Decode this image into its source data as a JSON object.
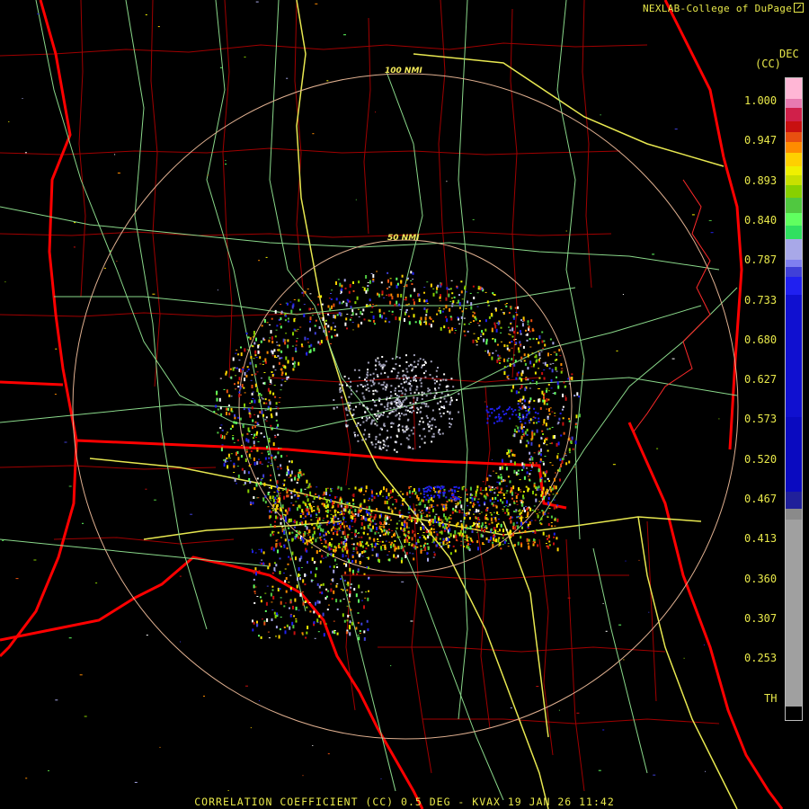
{
  "header": {
    "credit": "NEXLAB-College of DuPage"
  },
  "range_rings": [
    {
      "label": "100 NMI"
    },
    {
      "label": "50 NMI"
    }
  ],
  "legend": {
    "top_labels": [
      "DEC",
      "(CC)"
    ],
    "values": [
      "1.000",
      "0.947",
      "0.893",
      "0.840",
      "0.787",
      "0.733",
      "0.680",
      "0.627",
      "0.573",
      "0.520",
      "0.467",
      "0.413",
      "0.360",
      "0.307",
      "0.253",
      "TH"
    ],
    "colors": [
      "#ffb6d5",
      "#e87ab0",
      "#d0204a",
      "#c81010",
      "#e85010",
      "#ff8c00",
      "#ffd000",
      "#f0f000",
      "#c8e000",
      "#88d000",
      "#50c840",
      "#60ff60",
      "#30e060",
      "#a8a8e8",
      "#8080f0",
      "#4040d8",
      "#2020f0",
      "#1010d0",
      "#0a0ac0",
      "#20209a",
      "#8a8a8a",
      "#a0a0a0",
      "#000000"
    ]
  },
  "footer": {
    "text": "CORRELATION COEFFICIENT (CC) 0.5 DEG - KVAX 19 JAN 26 11:42"
  },
  "colors": {
    "state_border": "#ff0000",
    "county_border": "#b00000",
    "highway": "#e8e850",
    "road": "#90e090",
    "range_ring": "#e0b090",
    "text": "#e8e84a"
  }
}
